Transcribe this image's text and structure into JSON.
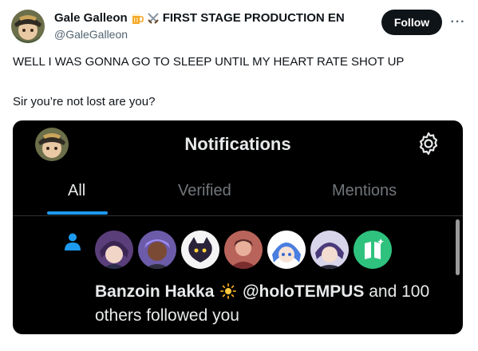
{
  "author": {
    "display_name": "Gale Galleon",
    "name_suffix": "FIRST STAGE PRODUCTION EN",
    "handle": "@GaleGalleon",
    "emoji_icons": [
      "beer-mug-icon",
      "crossed-swords-icon"
    ]
  },
  "actions": {
    "follow_label": "Follow",
    "more_icon": "more-icon"
  },
  "tweet": {
    "line1": "WELL I WAS GONNA GO TO SLEEP UNTIL MY HEART RATE SHOT UP",
    "line2": "Sir you’re not lost are you?"
  },
  "screenshot": {
    "title": "Notifications",
    "tabs": [
      {
        "label": "All",
        "active": true
      },
      {
        "label": "Verified",
        "active": false
      },
      {
        "label": "Mentions",
        "active": false
      }
    ],
    "notification": {
      "user_name": "Banzoin Hakka",
      "user_emoji": "sun-icon",
      "user_handle": "@holoTEMPUS",
      "rest": " and 100 others followed you",
      "follower_count": 7
    }
  },
  "colors": {
    "accent": "#1d9bf0",
    "text_primary": "#0f1419",
    "text_secondary": "#536471",
    "dark_bg": "#000000",
    "dark_text": "#e7e9ea",
    "dark_muted": "#71767b"
  }
}
